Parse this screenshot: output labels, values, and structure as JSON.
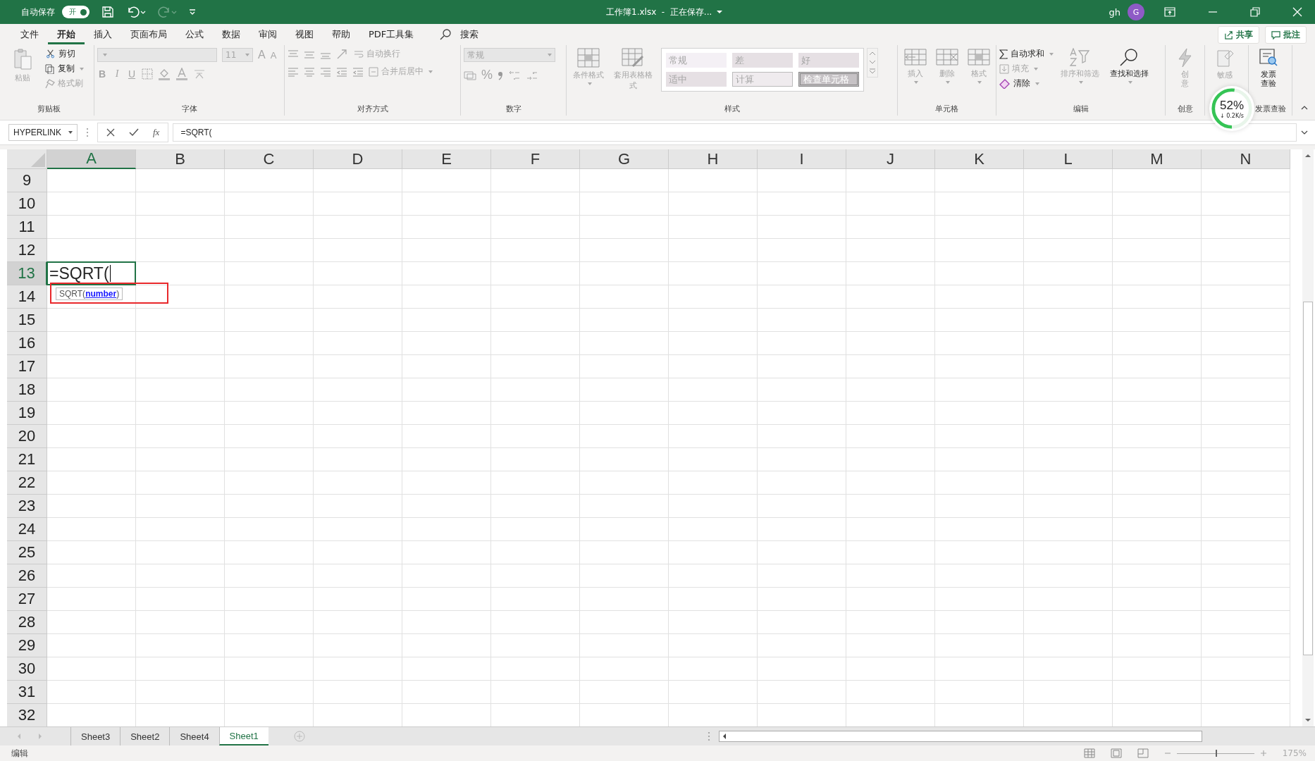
{
  "title_bar": {
    "autosave_label": "自动保存",
    "autosave": {
      "label": "开",
      "on": true
    },
    "title": "工作簿1.xlsx  -  正在保存...",
    "user": "gh",
    "avatar": "G"
  },
  "menu": [
    {
      "label": "文件",
      "selected": false
    },
    {
      "label": "开始",
      "selected": true
    },
    {
      "label": "插入",
      "selected": false
    },
    {
      "label": "页面布局",
      "selected": false
    },
    {
      "label": "公式",
      "selected": false
    },
    {
      "label": "数据",
      "selected": false
    },
    {
      "label": "审阅",
      "selected": false
    },
    {
      "label": "视图",
      "selected": false
    },
    {
      "label": "帮助",
      "selected": false
    },
    {
      "label": "PDF工具集",
      "selected": false
    }
  ],
  "search": "搜索",
  "share": "共享",
  "comments": "批注",
  "ribbon": {
    "clipboard": {
      "name": "剪贴板",
      "paste": {
        "label": "粘贴",
        "disabled": true
      },
      "items": [
        {
          "label": "剪切",
          "kind": "cut",
          "disabled": false,
          "dropdown": false
        },
        {
          "label": "复制",
          "kind": "copy",
          "disabled": false,
          "dropdown": true
        },
        {
          "label": "格式刷",
          "kind": "painter",
          "disabled": true,
          "dropdown": false
        }
      ]
    },
    "font": {
      "name": "字体",
      "disabled": true,
      "size": "11",
      "grow": "A",
      "shrink": "A",
      "styles": [
        {
          "label": "B",
          "kind": "bold"
        },
        {
          "label": "I",
          "kind": "italic"
        },
        {
          "label": "U",
          "kind": "underline"
        }
      ]
    },
    "alignment": {
      "name": "对齐方式",
      "disabled": true,
      "wrap": "自动换行",
      "merge": "合并后居中"
    },
    "number": {
      "name": "数字",
      "disabled": true,
      "format": "常规",
      "percent": "%"
    },
    "styles": {
      "name": "样式",
      "disabled": true,
      "conditional": "条件格式",
      "table": "套用表格格式",
      "gallery": [
        {
          "label": "常规",
          "color": "#f4f0f5",
          "kind": "plain"
        },
        {
          "label": "差",
          "color": "#e6e0e4",
          "kind": "plain"
        },
        {
          "label": "好",
          "color": "#e6e0e4",
          "kind": "plain"
        },
        {
          "label": "适中",
          "color": "#e6e0e4",
          "kind": "plain"
        },
        {
          "label": "计算",
          "color": "#efebee",
          "kind": "bordered"
        },
        {
          "label": "检查单元格",
          "color": "#c6c2c5",
          "kind": "double"
        }
      ]
    },
    "cells": {
      "name": "单元格",
      "disabled": true,
      "items": [
        {
          "label": "插入",
          "kind": "insert"
        },
        {
          "label": "删除",
          "kind": "delete"
        },
        {
          "label": "格式",
          "kind": "format"
        }
      ]
    },
    "editing": {
      "name": "编辑",
      "items": [
        {
          "label": "自动求和",
          "kind": "sum",
          "disabled": false
        },
        {
          "label": "填充",
          "kind": "fill",
          "disabled": true
        },
        {
          "label": "清除",
          "kind": "clear",
          "disabled": false
        }
      ],
      "sort": {
        "label": "排序和筛选",
        "disabled": true
      },
      "find": {
        "label": "查找和选择",
        "disabled": false
      }
    },
    "extra": [
      {
        "name": "创意",
        "label": "创意",
        "kind": "bolt",
        "disabled": true
      },
      {
        "label": "敏感",
        "kind": "sensitivity",
        "disabled": true
      },
      {
        "name": "发票查验",
        "label": "发票查验",
        "kind": "invoice",
        "disabled": false
      }
    ]
  },
  "formula_bar": {
    "name_box": "HYPERLINK",
    "fx": "fx",
    "formula": "=SQRT("
  },
  "sheet": {
    "columns": [
      {
        "label": "A",
        "selected": true
      },
      {
        "label": "B",
        "selected": false
      },
      {
        "label": "C",
        "selected": false
      },
      {
        "label": "D",
        "selected": false
      },
      {
        "label": "E",
        "selected": false
      },
      {
        "label": "F",
        "selected": false
      },
      {
        "label": "G",
        "selected": false
      },
      {
        "label": "H",
        "selected": false
      },
      {
        "label": "I",
        "selected": false
      },
      {
        "label": "J",
        "selected": false
      },
      {
        "label": "K",
        "selected": false
      },
      {
        "label": "L",
        "selected": false
      },
      {
        "label": "M",
        "selected": false
      },
      {
        "label": "N",
        "selected": false
      }
    ],
    "rows": [
      {
        "label": "9",
        "selected": false
      },
      {
        "label": "10",
        "selected": false
      },
      {
        "label": "11",
        "selected": false
      },
      {
        "label": "12",
        "selected": false
      },
      {
        "label": "13",
        "selected": true,
        "cells": [
          "=SQRT("
        ]
      },
      {
        "label": "14",
        "selected": false
      },
      {
        "label": "15",
        "selected": false
      },
      {
        "label": "16",
        "selected": false
      },
      {
        "label": "17",
        "selected": false
      },
      {
        "label": "18",
        "selected": false
      },
      {
        "label": "19",
        "selected": false
      },
      {
        "label": "20",
        "selected": false
      },
      {
        "label": "21",
        "selected": false
      },
      {
        "label": "22",
        "selected": false
      },
      {
        "label": "23",
        "selected": false
      },
      {
        "label": "24",
        "selected": false
      },
      {
        "label": "25",
        "selected": false
      },
      {
        "label": "26",
        "selected": false
      },
      {
        "label": "27",
        "selected": false
      },
      {
        "label": "28",
        "selected": false
      },
      {
        "label": "29",
        "selected": false
      },
      {
        "label": "30",
        "selected": false
      },
      {
        "label": "31",
        "selected": false
      },
      {
        "label": "32",
        "selected": false
      }
    ],
    "tooltip": {
      "text": "SQRT(**number**)",
      "highlighted": true
    }
  },
  "sheet_tabs": [
    {
      "label": "Sheet3",
      "selected": false
    },
    {
      "label": "Sheet2",
      "selected": false
    },
    {
      "label": "Sheet4",
      "selected": false
    },
    {
      "label": "Sheet1",
      "selected": true
    }
  ],
  "status_bar": {
    "mode": "编辑",
    "zoom": {
      "label": "175%",
      "level": 0.5
    }
  },
  "network_widget": {
    "percent": "52%",
    "speed": "↓ 0.2K/s",
    "level": 0.52
  }
}
